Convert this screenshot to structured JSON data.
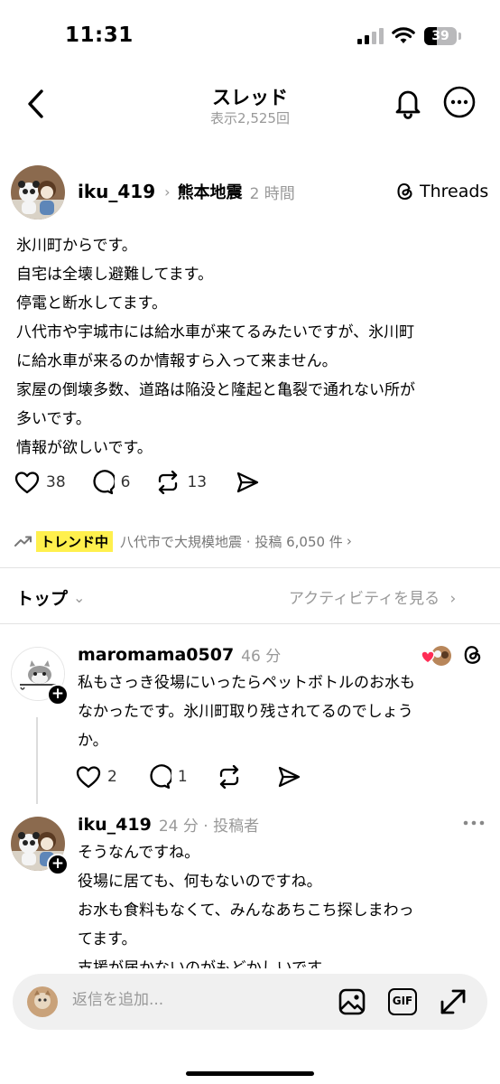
{
  "status_bar": {
    "time": "11:31",
    "battery": "39",
    "battery_level": 0.39
  },
  "nav": {
    "title": "スレッド",
    "views": "表示2,525回"
  },
  "post": {
    "username": "iku_419",
    "topic": "熊本地震",
    "time": "2 時間",
    "threads_label": "Threads",
    "body_lines": [
      "氷川町からです。",
      "自宅は全壊し避難してます。",
      "停電と断水してます。",
      "八代市や宇城市には給水車が来てるみたいですが、氷川町",
      "に給水車が来るのか情報すら入って来ません。",
      "家屋の倒壊多数、道路は陥没と隆起と亀裂で通れない所が",
      "多いです。",
      "情報が欲しいです。"
    ],
    "likes": "38",
    "replies": "6",
    "reposts": "13"
  },
  "trend": {
    "badge": "トレンド中",
    "text": "八代市で大規模地震 · 投稿 6,050 件"
  },
  "sort": {
    "label": "トップ",
    "activity_link": "アクティビティを見る"
  },
  "replies": [
    {
      "username": "maromama0507",
      "time": "46 分",
      "body_lines": [
        "私もさっき役場にいったらペットボトルのお水も",
        "なかったです。氷川町取り残されてるのでしょう",
        "か。"
      ],
      "likes": "2",
      "replies": "1"
    },
    {
      "username": "iku_419",
      "time": "24 分 · 投稿者",
      "body_lines": [
        "そうなんですね。",
        "役場に居ても、何もないのですね。",
        "お水も食料もなくて、みんなあちこち探しまわっ",
        "てます。",
        "支援が届かないのがもどかしいです。"
      ]
    }
  ],
  "composer": {
    "placeholder": "返信を追加...",
    "gif_label": "GIF"
  }
}
